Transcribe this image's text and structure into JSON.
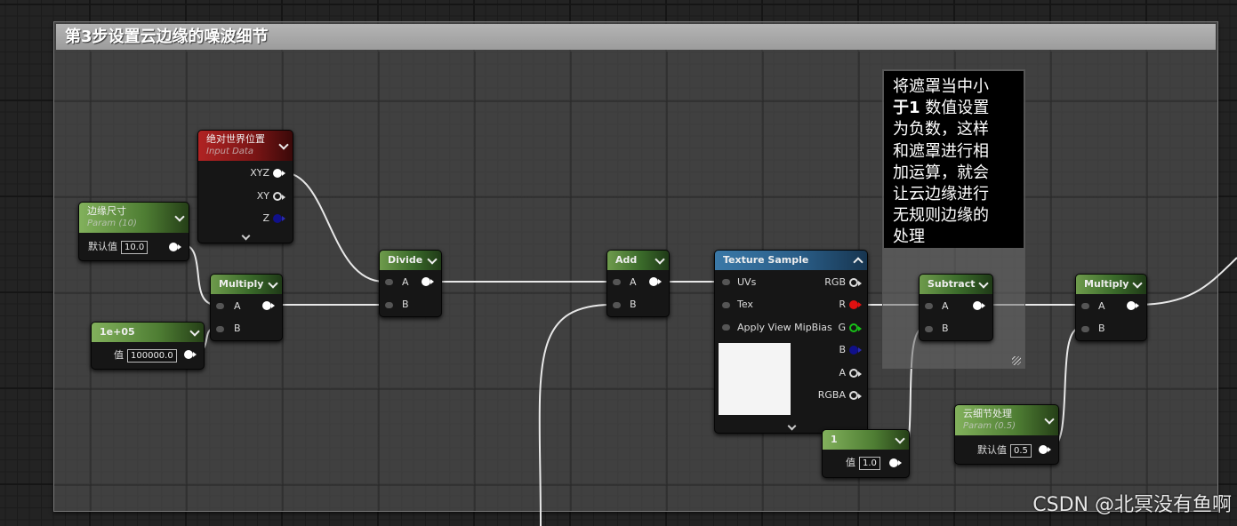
{
  "comment": {
    "title": "第3步设置云边缘的噪波细节",
    "note_line1": "将遮罩当中小",
    "note_line2_bold": "于1",
    "note_line2_rest": " 数值设置",
    "note_line3": "为负数，这样",
    "note_line4": "和遮罩进行相",
    "note_line5": "加运算，就会",
    "note_line6": "让云边缘进行",
    "note_line7": "无规则边缘的",
    "note_line8": "处理"
  },
  "nodes": {
    "world_pos": {
      "title": "绝对世界位置",
      "subtitle": "Input Data",
      "pin_xyz": "XYZ",
      "pin_xy": "XY",
      "pin_z": "Z"
    },
    "edge_size": {
      "title": "边缘尺寸",
      "subtitle": "Param (10)",
      "label": "默认值",
      "value": "10.0"
    },
    "constant_big": {
      "title": "1e+05",
      "label": "值",
      "value": "100000.0"
    },
    "multiply1": {
      "title": "Multiply",
      "pin_a": "A",
      "pin_b": "B"
    },
    "divide": {
      "title": "Divide",
      "pin_a": "A",
      "pin_b": "B"
    },
    "add": {
      "title": "Add",
      "pin_a": "A",
      "pin_b": "B"
    },
    "texture_sample": {
      "title": "Texture Sample",
      "in_uvs": "UVs",
      "in_tex": "Tex",
      "in_mip": "Apply View MipBias",
      "out_rgb": "RGB",
      "out_r": "R",
      "out_g": "G",
      "out_b": "B",
      "out_a": "A",
      "out_rgba": "RGBA"
    },
    "constant_one": {
      "title": "1",
      "label": "值",
      "value": "1.0"
    },
    "subtract": {
      "title": "Subtract",
      "pin_a": "A",
      "pin_b": "B"
    },
    "multiply2": {
      "title": "Multiply",
      "pin_a": "A",
      "pin_b": "B"
    },
    "cloud_detail": {
      "title": "云细节处理",
      "subtitle": "Param (0.5)",
      "label": "默认值",
      "value": "0.5"
    }
  },
  "watermark": "CSDN @北冥没有鱼啊",
  "colors": {
    "param_header": "#4e7d33",
    "input_header": "#7a1515",
    "texture_header": "#2a5e88",
    "wire": "#ffffff"
  }
}
